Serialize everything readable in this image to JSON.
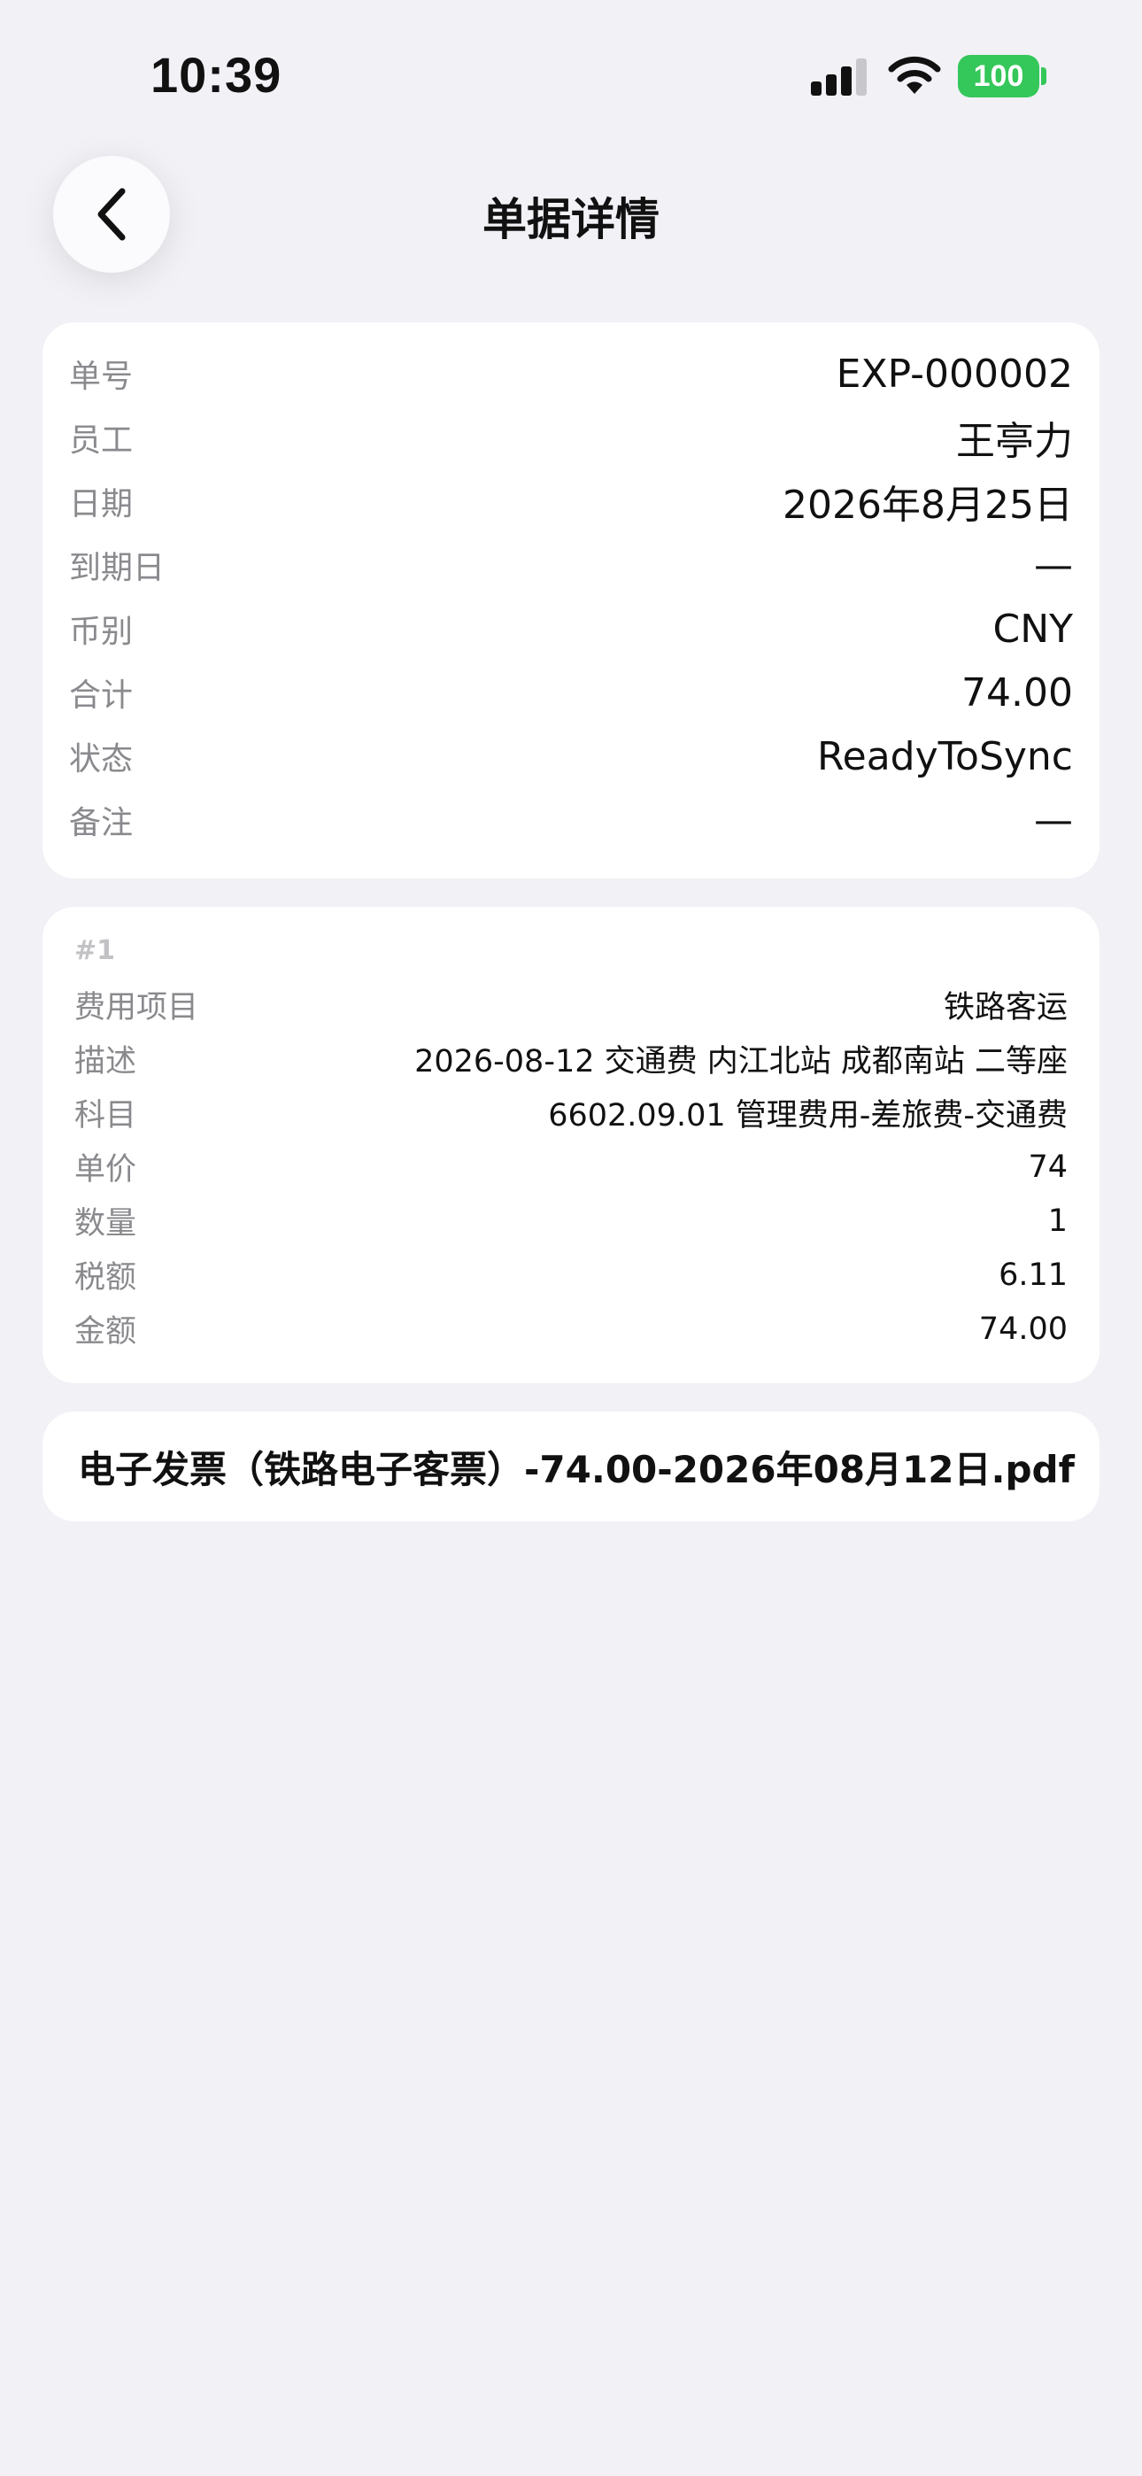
{
  "status_bar": {
    "time": "10:39",
    "battery": "100",
    "icons": [
      "signal-icon",
      "wifi-icon",
      "battery-icon"
    ]
  },
  "nav": {
    "title": "单据详情",
    "back_icon": "chevron-left-icon"
  },
  "header": {
    "rows": [
      {
        "label": "单号",
        "value": "EXP-000002"
      },
      {
        "label": "员工",
        "value": "王亭力"
      },
      {
        "label": "日期",
        "value": "2026年8月25日"
      },
      {
        "label": "到期日",
        "value": "—"
      },
      {
        "label": "币别",
        "value": "CNY"
      },
      {
        "label": "合计",
        "value": "74.00"
      },
      {
        "label": "状态",
        "value": "ReadyToSync"
      },
      {
        "label": "备注",
        "value": "—"
      }
    ]
  },
  "lines": [
    {
      "index": "#1",
      "rows": [
        {
          "label": "费用项目",
          "value": "铁路客运"
        },
        {
          "label": "描述",
          "value": "2026-08-12 交通费 内江北站 成都南站 二等座"
        },
        {
          "label": "科目",
          "value": "6602.09.01 管理费用-差旅费-交通费"
        },
        {
          "label": "单价",
          "value": "74"
        },
        {
          "label": "数量",
          "value": "1"
        },
        {
          "label": "税额",
          "value": "6.11"
        },
        {
          "label": "金额",
          "value": "74.00"
        }
      ]
    }
  ],
  "attachment": {
    "file_name": "电子发票（铁路电子客票）-74.00-2026年08月12日.pdf"
  },
  "colors": {
    "background": "#f1f1f6",
    "card": "#ffffff",
    "label": "#8a8a8e",
    "battery": "#34c759"
  }
}
